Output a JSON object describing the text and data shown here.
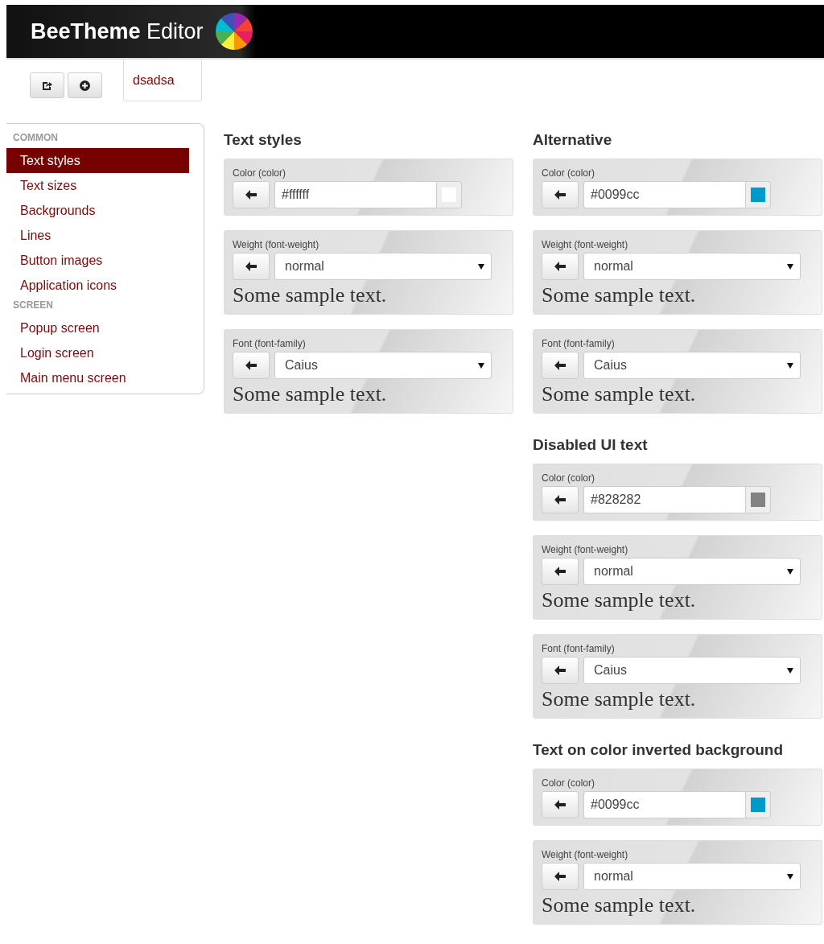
{
  "header": {
    "brand_bold": "BeeTheme",
    "brand_light": "Editor"
  },
  "toolbar": {
    "tab": {
      "label": "dsadsa",
      "selected": true
    }
  },
  "sidebar": [
    {
      "section": "COMMON",
      "items": [
        {
          "label": "Text styles",
          "selected": true
        },
        {
          "label": "Text sizes",
          "selected": false
        },
        {
          "label": "Backgrounds",
          "selected": false
        },
        {
          "label": "Lines",
          "selected": false
        },
        {
          "label": "Button images",
          "selected": false
        },
        {
          "label": "Application icons",
          "selected": false
        }
      ]
    },
    {
      "section": "SCREEN",
      "items": [
        {
          "label": "Popup screen",
          "selected": false
        },
        {
          "label": "Login screen",
          "selected": false
        },
        {
          "label": "Main menu screen",
          "selected": false
        }
      ]
    }
  ],
  "columns": [
    [
      {
        "title": "Text styles",
        "props": [
          {
            "kind": "color",
            "label": "Color (color)",
            "value": "#ffffff",
            "color": "#ffffff"
          },
          {
            "kind": "select",
            "label": "Weight (font-weight)",
            "value": "normal",
            "sample": "Some sample text."
          },
          {
            "kind": "select",
            "label": "Font (font-family)",
            "value": "Caius",
            "sample": "Some sample text."
          }
        ]
      }
    ],
    [
      {
        "title": "Alternative",
        "props": [
          {
            "kind": "color",
            "label": "Color (color)",
            "value": "#0099cc",
            "color": "#0099cc"
          },
          {
            "kind": "select",
            "label": "Weight (font-weight)",
            "value": "normal",
            "sample": "Some sample text."
          },
          {
            "kind": "select",
            "label": "Font (font-family)",
            "value": "Caius",
            "sample": "Some sample text."
          }
        ]
      },
      {
        "title": "Disabled UI text",
        "props": [
          {
            "kind": "color",
            "label": "Color (color)",
            "value": "#828282",
            "color": "#828282"
          },
          {
            "kind": "select",
            "label": "Weight (font-weight)",
            "value": "normal",
            "sample": "Some sample text."
          },
          {
            "kind": "select",
            "label": "Font (font-family)",
            "value": "Caius",
            "sample": "Some sample text."
          }
        ]
      },
      {
        "title": "Text on color inverted background",
        "props": [
          {
            "kind": "color",
            "label": "Color (color)",
            "value": "#0099cc",
            "color": "#0099cc"
          },
          {
            "kind": "select",
            "label": "Weight (font-weight)",
            "value": "normal",
            "sample": "Some sample text."
          }
        ]
      }
    ]
  ]
}
